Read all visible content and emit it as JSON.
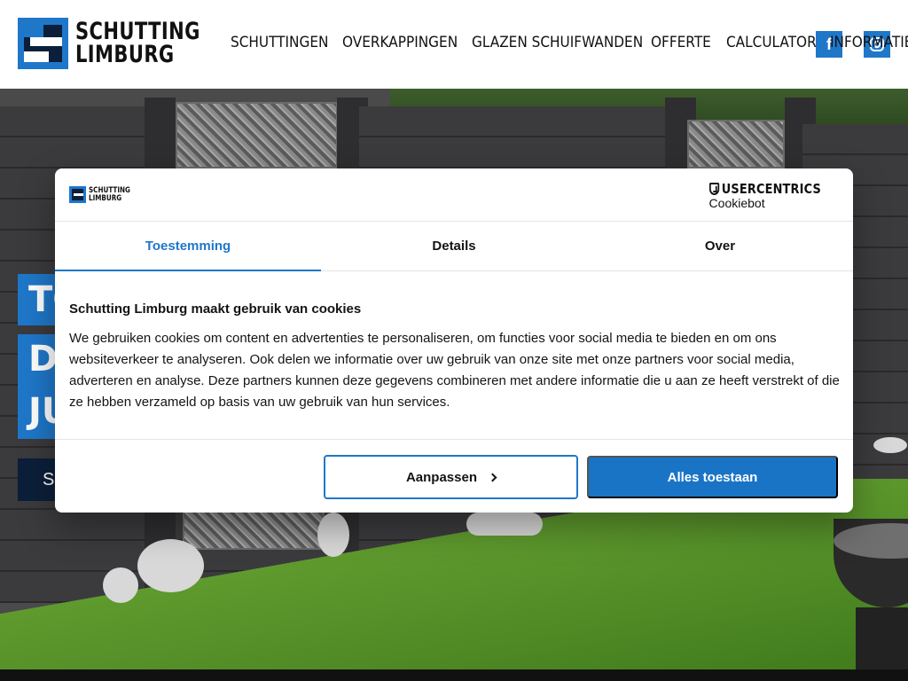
{
  "header": {
    "logo": {
      "line1": "SCHUTTING",
      "line2": "LIMBURG"
    },
    "nav": [
      {
        "label": "SCHUTTINGEN"
      },
      {
        "label": "OVERKAPPINGEN"
      },
      {
        "label": "GLAZEN SCHUIFWANDEN"
      },
      {
        "label": "OFFERTE"
      },
      {
        "label": "CALCULATOR"
      },
      {
        "label": "INFORMATIE"
      }
    ],
    "social": {
      "facebook_glyph": "f",
      "instagram_icon": "instagram-icon"
    }
  },
  "hero": {
    "lines": [
      "TO",
      "DA",
      "JU"
    ],
    "button_label": "S"
  },
  "cookie_dialog": {
    "logo": {
      "line1": "SCHUTTING",
      "line2": "LIMBURG"
    },
    "provider": {
      "brand": "USERCENTRICS",
      "product": "Cookiebot"
    },
    "tabs": [
      {
        "label": "Toestemming",
        "active": true
      },
      {
        "label": "Details",
        "active": false
      },
      {
        "label": "Over",
        "active": false
      }
    ],
    "title": "Schutting Limburg maakt gebruik van cookies",
    "body": "We gebruiken cookies om content en advertenties te personaliseren, om functies voor social media te bieden en om ons websiteverkeer te analyseren. Ook delen we informatie over uw gebruik van onze site met onze partners voor social media, adverteren en analyse. Deze partners kunnen deze gegevens combineren met andere informatie die u aan ze heeft verstrekt of die ze hebben verzameld op basis van uw gebruik van hun services.",
    "buttons": {
      "customize": "Aanpassen",
      "allow_all": "Alles toestaan"
    }
  },
  "colors": {
    "brand_blue": "#1f77c9",
    "navy": "#0c1f3a",
    "allow_button": "#1a74c6"
  }
}
